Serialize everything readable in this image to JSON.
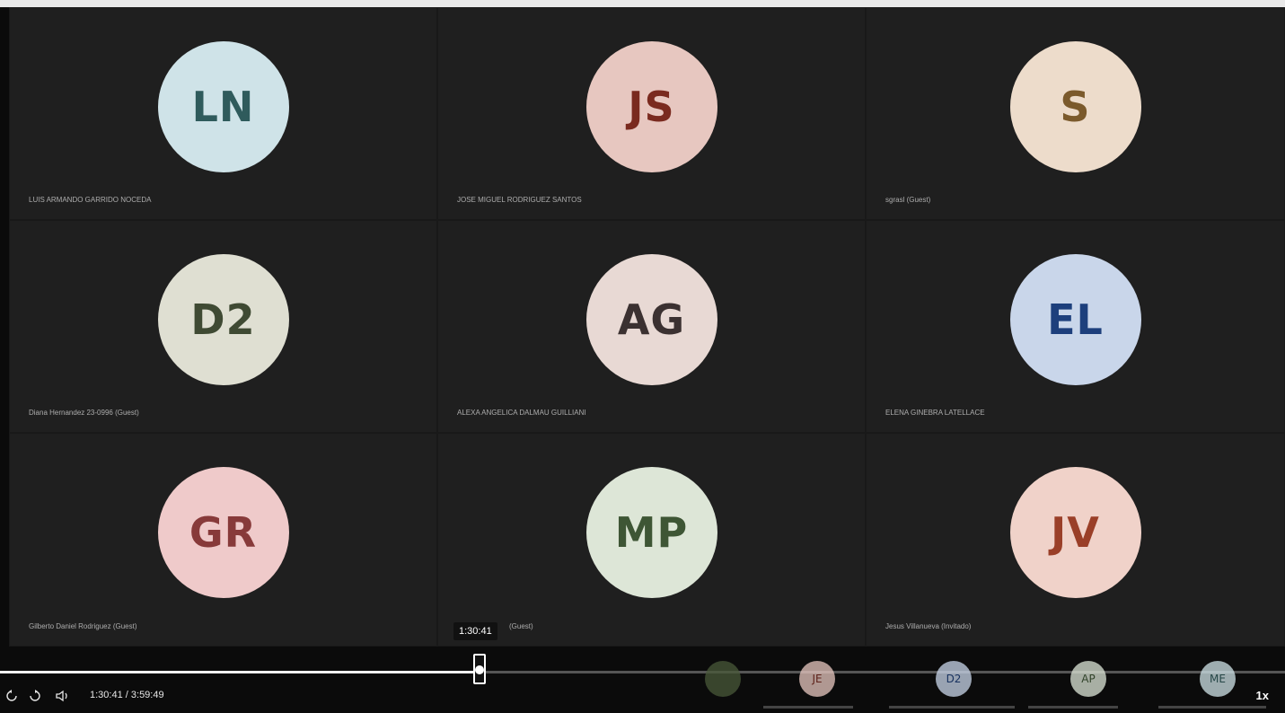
{
  "participants": [
    {
      "initials": "LN",
      "name": "LUIS ARMANDO GARRIDO NOCEDA",
      "bg": "#cfe3e8",
      "fg": "#2f5b5c"
    },
    {
      "initials": "JS",
      "name": "JOSE MIGUEL RODRIGUEZ SANTOS",
      "bg": "#e7c7c0",
      "fg": "#7a2a1f"
    },
    {
      "initials": "S",
      "name": "sgrasl (Guest)",
      "bg": "#eddccb",
      "fg": "#7b5a2c"
    },
    {
      "initials": "D2",
      "name": "Diana Hernandez 23-0996 (Guest)",
      "bg": "#dfdfd2",
      "fg": "#3f4a33"
    },
    {
      "initials": "AG",
      "name": "ALEXA ANGELICA DALMAU GUILLIANI",
      "bg": "#e8d9d4",
      "fg": "#3b3131"
    },
    {
      "initials": "EL",
      "name": "ELENA GINEBRA LATELLACE",
      "bg": "#c9d6ea",
      "fg": "#1d3f7c"
    },
    {
      "initials": "GR",
      "name": "Gilberto Daniel Rodriguez (Guest)",
      "bg": "#efcaca",
      "fg": "#873a3a"
    },
    {
      "initials": "MP",
      "name": "(Guest)",
      "bg": "#dde6d7",
      "fg": "#3e5635"
    },
    {
      "initials": "JV",
      "name": "Jesus Villanueva (Invitado)",
      "bg": "#f0d2c9",
      "fg": "#9a3f28"
    }
  ],
  "player": {
    "tooltip_time": "1:30:41",
    "current_time": "1:30:41",
    "separator": "/",
    "duration": "3:59:49",
    "progress_fraction": 0.378,
    "speed": "1x",
    "rewind_label": "10",
    "forward_label": "10"
  },
  "thumbnail_strip": [
    {
      "initials": "",
      "bg": "#4a5a3a",
      "fg": "#ffffff"
    },
    {
      "initials": "JE",
      "bg": "#e7c7c0",
      "fg": "#7a2a1f"
    },
    {
      "initials": "D2",
      "bg": "#c9d6ea",
      "fg": "#1d3f7c"
    },
    {
      "initials": "AP",
      "bg": "#dde6d7",
      "fg": "#3e5635"
    },
    {
      "initials": "ME",
      "bg": "#cfe3e8",
      "fg": "#2f5b5c"
    }
  ]
}
